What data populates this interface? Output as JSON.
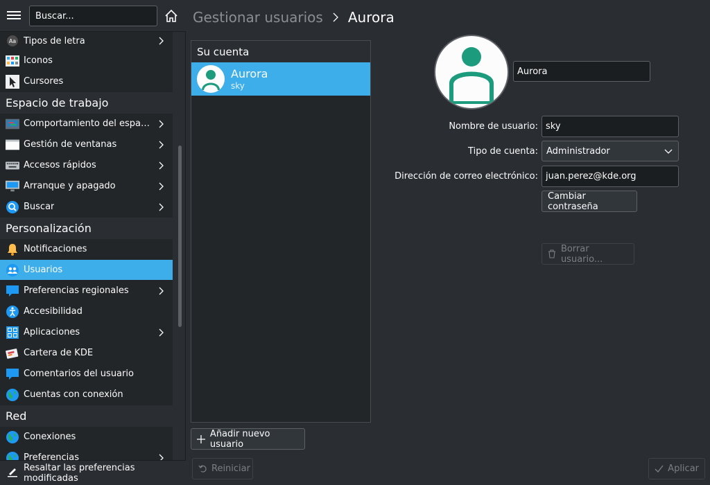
{
  "sidebar": {
    "search_placeholder": "Buscar...",
    "items": [
      {
        "label": "Tipos de letra",
        "icon": "font-icon",
        "chevron": true
      },
      {
        "label": "Iconos",
        "icon": "icons-icon",
        "chevron": false
      },
      {
        "label": "Cursores",
        "icon": "cursor-icon",
        "chevron": false
      }
    ],
    "section_workspace": "Espacio de trabajo",
    "workspace_items": [
      {
        "label": "Comportamiento del espacio...",
        "icon": "desktop-behavior-icon",
        "chevron": true
      },
      {
        "label": "Gestión de ventanas",
        "icon": "window-icon",
        "chevron": true
      },
      {
        "label": "Accesos rápidos",
        "icon": "keyboard-icon",
        "chevron": true
      },
      {
        "label": "Arranque y apagado",
        "icon": "monitor-icon",
        "chevron": true
      },
      {
        "label": "Buscar",
        "icon": "search-icon",
        "chevron": true
      }
    ],
    "section_personalization": "Personalización",
    "personal_items": [
      {
        "label": "Notificaciones",
        "icon": "bell-icon",
        "chevron": false
      },
      {
        "label": "Usuarios",
        "icon": "users-icon",
        "chevron": false
      },
      {
        "label": "Preferencias regionales",
        "icon": "chat-icon",
        "chevron": true
      },
      {
        "label": "Accesibilidad",
        "icon": "accessibility-icon",
        "chevron": false
      },
      {
        "label": "Aplicaciones",
        "icon": "apps-icon",
        "chevron": true
      },
      {
        "label": "Cartera de KDE",
        "icon": "wallet-icon",
        "chevron": false
      },
      {
        "label": "Comentarios del usuario",
        "icon": "feedback-icon",
        "chevron": false
      },
      {
        "label": "Cuentas con conexión",
        "icon": "globe-icon",
        "chevron": false
      }
    ],
    "section_network": "Red",
    "network_items": [
      {
        "label": "Conexiones",
        "icon": "globe-icon",
        "chevron": false
      },
      {
        "label": "Preferencias",
        "icon": "globe-icon",
        "chevron": true
      }
    ],
    "highlight_label": "Resaltar las preferencias modificadas"
  },
  "header": {
    "parent": "Gestionar usuarios",
    "current": "Aurora"
  },
  "users_panel": {
    "title": "Su cuenta",
    "user_name": "Aurora",
    "user_login": "sky",
    "add_button": "Añadir nuevo usuario"
  },
  "form": {
    "real_name": "Aurora",
    "username_label": "Nombre de usuario:",
    "username": "sky",
    "account_type_label": "Tipo de cuenta:",
    "account_type": "Administrador",
    "email_label": "Dirección de correo electrónico:",
    "email": "juan.perez@kde.org",
    "change_password": "Cambiar contraseña",
    "delete_user": "Borrar usuario..."
  },
  "footer": {
    "reset": "Reiniciar",
    "apply": "Aplicar"
  },
  "colors": {
    "accent": "#3daee9",
    "avatar_green": "#1d9c7d"
  }
}
